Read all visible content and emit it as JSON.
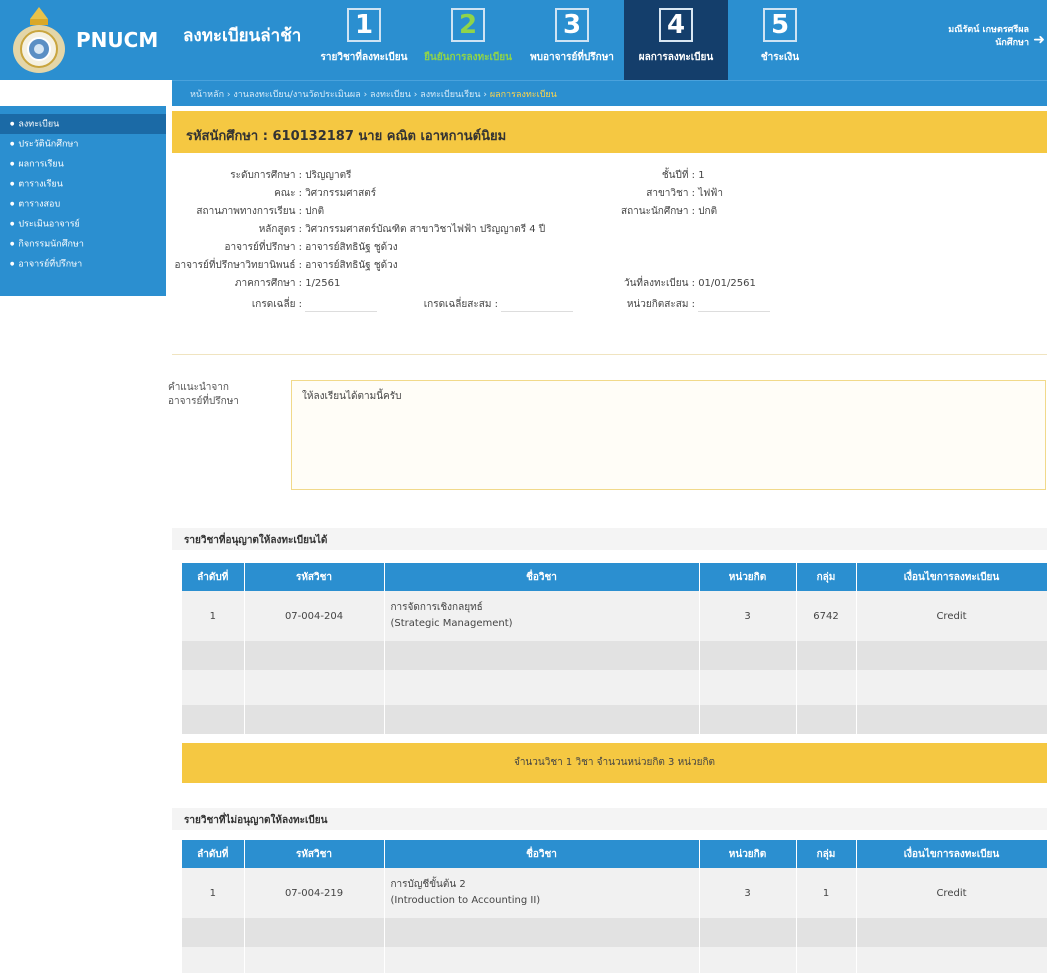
{
  "header": {
    "logo_text": "PNUCM",
    "app_title": "ลงทะเบียนล่าช้า",
    "steps": [
      {
        "num": "1",
        "label": "รายวิชาที่ลงทะเบียน"
      },
      {
        "num": "2",
        "label": "ยืนยันการลงทะเบียน"
      },
      {
        "num": "3",
        "label": "พบอาจารย์ที่ปรึกษา"
      },
      {
        "num": "4",
        "label": "ผลการลงทะเบียน"
      },
      {
        "num": "5",
        "label": "ชำระเงิน"
      }
    ],
    "breadcrumb": "หน้าหลัก › งานลงทะเบียน/งานวัดประเมินผล › ลงทะเบียน › ลงทะเบียนเรียน ›",
    "breadcrumb_current": "ผลการลงทะเบียน",
    "user_name": "มณีรัตน์ เกษตรศรีผล",
    "user_role": "นักศึกษา"
  },
  "sidebar": {
    "items": [
      "ลงทะเบียน",
      "ประวัตินักศึกษา",
      "ผลการเรียน",
      "ตารางเรียน",
      "ตารางสอบ",
      "ประเมินอาจารย์",
      "กิจกรรมนักศึกษา",
      "อาจารย์ที่ปรึกษา"
    ]
  },
  "student": {
    "header": "รหัสนักศึกษา : 610132187 นาย คณิต เอาหกานต์นิยม",
    "level_label": "ระดับการศึกษา :",
    "level": "ปริญญาตรี",
    "year_label": "ชั้นปีที่ :",
    "year": "1",
    "faculty_label": "คณะ :",
    "faculty": "วิศวกรรมศาสตร์",
    "major_label": "สาขาวิชา :",
    "major": "ไฟฟ้า",
    "academic_status_label": "สถานภาพทางการเรียน :",
    "academic_status": "ปกติ",
    "student_status_label": "สถานะนักศึกษา :",
    "student_status": "ปกติ",
    "curriculum_label": "หลักสูตร :",
    "curriculum": "วิศวกรรมศาสตร์บัณฑิต สาขาวิชาไฟฟ้า ปริญญาตรี 4 ปี",
    "advisor_label": "อาจารย์ที่ปรึกษา :",
    "advisor": "อาจารย์สิทธินัฐ ชูด้วง",
    "thesis_advisor_label": "อาจารย์ที่ปรึกษาวิทยานิพนธ์ :",
    "thesis_advisor": "อาจารย์สิทธินัฐ ชูด้วง",
    "semester_label": "ภาคการศึกษา :",
    "semester": "1/2561",
    "reg_date_label": "วันที่ลงทะเบียน :",
    "reg_date": "01/01/2561",
    "gpa_label": "เกรดเฉลี่ย :",
    "gpax_label": "เกรดเฉลี่ยสะสม :",
    "credits_label": "หน่วยกิตสะสม :"
  },
  "advice": {
    "label_line1": "คำแนะนำจาก",
    "label_line2": "อาจารย์ที่ปรึกษา",
    "text": "ให้ลงเรียนได้ตามนี้ครับ"
  },
  "allowed": {
    "title": "รายวิชาที่อนุญาตให้ลงทะเบียนได้",
    "columns": [
      "ลำดับที่",
      "รหัสวิชา",
      "ชื่อวิชา",
      "หน่วยกิต",
      "กลุ่ม",
      "เงื่อนไขการลงทะเบียน"
    ],
    "row": {
      "no": "1",
      "code": "07-004-204",
      "name_th": "การจัดการเชิงกลยุทธ์",
      "name_en": "(Strategic Management)",
      "credits": "3",
      "group": "6742",
      "condition": "Credit"
    },
    "summary": "จำนวนวิชา 1 วิชา  จำนวนหน่วยกิต 3 หน่วยกิต"
  },
  "not_allowed": {
    "title": "รายวิชาที่ไม่อนุญาตให้ลงทะเบียน",
    "columns": [
      "ลำดับที่",
      "รหัสวิชา",
      "ชื่อวิชา",
      "หน่วยกิต",
      "กลุ่ม",
      "เงื่อนไขการลงทะเบียน"
    ],
    "row": {
      "no": "1",
      "code": "07-004-219",
      "name_th": "การบัญชีขั้นต้น 2",
      "name_en": "(Introduction to Accounting II)",
      "credits": "3",
      "group": "1",
      "condition": "Credit"
    }
  }
}
